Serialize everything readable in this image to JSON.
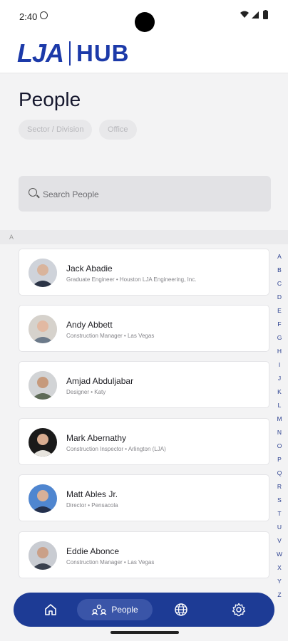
{
  "status": {
    "time": "2:40"
  },
  "brand": {
    "left": "LJA",
    "right": "HUB"
  },
  "page": {
    "title": "People"
  },
  "filters": [
    "Sector / Division",
    "Office"
  ],
  "search": {
    "placeholder": "Search People"
  },
  "section": {
    "letter": "A"
  },
  "people": [
    {
      "name": "Jack Abadie",
      "meta": "Graduate Engineer • Houston LJA Engineering, Inc.",
      "shirt": "#2b3446",
      "skin": "#d9b49c"
    },
    {
      "name": "Andy Abbett",
      "meta": "Construction Manager • Las Vegas",
      "shirt": "#6c7a8a",
      "skin": "#e2b9a2"
    },
    {
      "name": "Amjad Abduljabar",
      "meta": "Designer • Katy",
      "shirt": "#5e6b57",
      "skin": "#c69a7c"
    },
    {
      "name": "Mark Abernathy",
      "meta": "Construction Inspector • Arlington (LJA)",
      "shirt": "#e7e4de",
      "skin": "#d8ac90"
    },
    {
      "name": "Matt Ables Jr.",
      "meta": "Director • Pensacola",
      "shirt": "#24304c",
      "skin": "#d8b098"
    },
    {
      "name": "Eddie Abonce",
      "meta": "Construction Manager • Las Vegas",
      "shirt": "#39404e",
      "skin": "#caa088"
    }
  ],
  "alphabet": [
    "A",
    "B",
    "C",
    "D",
    "E",
    "F",
    "G",
    "H",
    "I",
    "J",
    "K",
    "L",
    "M",
    "N",
    "O",
    "P",
    "Q",
    "R",
    "S",
    "T",
    "U",
    "V",
    "W",
    "X",
    "Y",
    "Z"
  ],
  "nav": {
    "people_label": "People"
  },
  "colors": {
    "brand": "#1c3aa9",
    "nav_bg": "#1d3b95"
  }
}
